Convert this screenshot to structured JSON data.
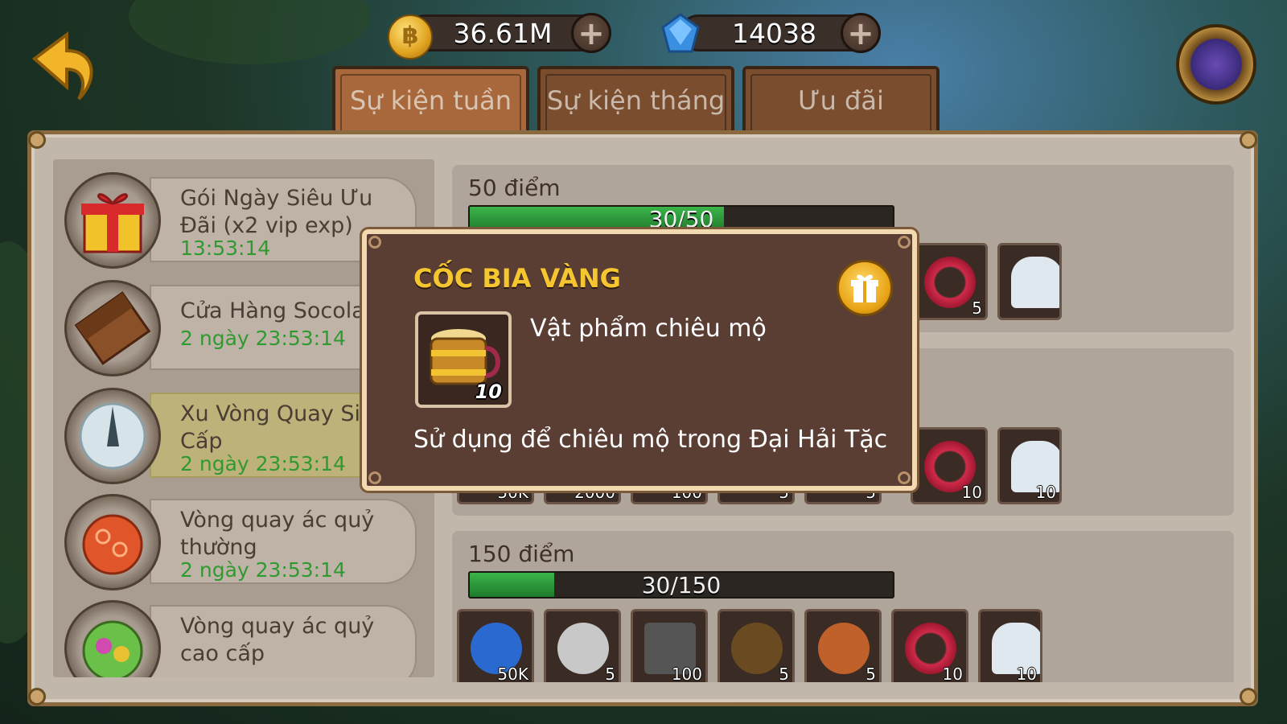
{
  "currency": {
    "gold": "36.61M",
    "gems": "14038"
  },
  "tabs": [
    {
      "label": "Sự kiện tuần",
      "active": true
    },
    {
      "label": "Sự kiện tháng",
      "active": false
    },
    {
      "label": "Ưu đãi",
      "active": false
    }
  ],
  "events": [
    {
      "title": "Gói Ngày Siêu Ưu\nĐãi (x2 vip exp)",
      "timer": "13:53:14",
      "icon": "gift-box-icon"
    },
    {
      "title": "Cửa Hàng Socola",
      "timer": "2 ngày 23:53:14",
      "icon": "chocolate-icon"
    },
    {
      "title": "Xu Vòng Quay Siê\nCấp",
      "timer": "2 ngày 23:53:14",
      "icon": "spin-coin-icon"
    },
    {
      "title": "Vòng quay ác quỷ\nthường",
      "timer": "2 ngày 23:53:14",
      "icon": "devil-fruit-icon"
    },
    {
      "title": "Vòng quay ác quỷ\ncao cấp",
      "timer": "",
      "icon": "rainbow-devil-fruit-icon"
    }
  ],
  "rewards": [
    {
      "title": "50 điểm",
      "progress_text": "30/50",
      "progress": 0.6,
      "items": [
        "",
        "",
        "",
        "",
        "",
        "5",
        ""
      ]
    },
    {
      "title": "",
      "progress_text": "",
      "progress": 0.3,
      "items": [
        "50K",
        "2000",
        "100",
        "5",
        "5",
        "10",
        "10"
      ]
    },
    {
      "title": "150 điểm",
      "progress_text": "30/150",
      "progress": 0.2,
      "items": [
        "50K",
        "5",
        "100",
        "5",
        "5",
        "10",
        "10"
      ]
    }
  ],
  "popup": {
    "title": "CỐC BIA VÀNG",
    "item_type": "Vật phẩm chiêu mộ",
    "item_count": "10",
    "description": "Sử dụng để chiêu mộ trong Đại Hải Tặc"
  },
  "colors": {
    "title_gold": "#f6c631",
    "timer_green": "#2f9a2f",
    "progress_green": "#3bb54a"
  }
}
